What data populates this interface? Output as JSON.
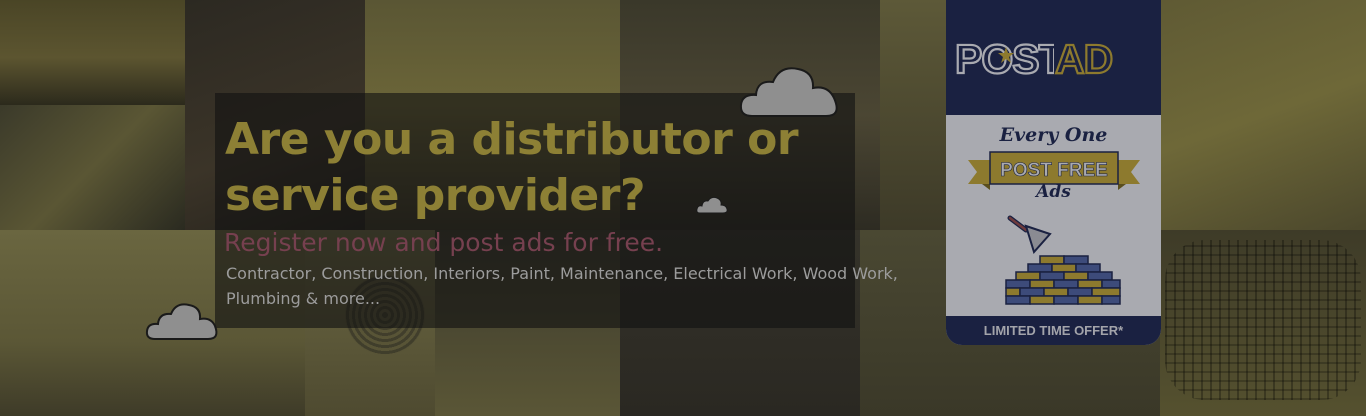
{
  "banner": {
    "headline": "Are you a distributor or service provider?",
    "subheadline": "Register now and post ads for free.",
    "services_list": "Contractor, Construction, Interiors, Paint, Maintenance, Electrical Work, Wood Work, Plumbing & more...",
    "colors": {
      "headline": "#8d8035",
      "subheadline": "#76404f",
      "body_text": "#9c9c9c",
      "overlay": "#121212"
    }
  },
  "promo": {
    "logo_post": "POST",
    "logo_ad": "AD",
    "tagline_top": "Every One",
    "ribbon_text": "POST FREE",
    "tagline_bottom": "Ads",
    "footer": "LIMITED TIME OFFER*",
    "colors": {
      "navy": "#1a2141",
      "gold": "#8d7a2e",
      "panel": "#a9aab0",
      "red": "#6e3a3c"
    }
  }
}
